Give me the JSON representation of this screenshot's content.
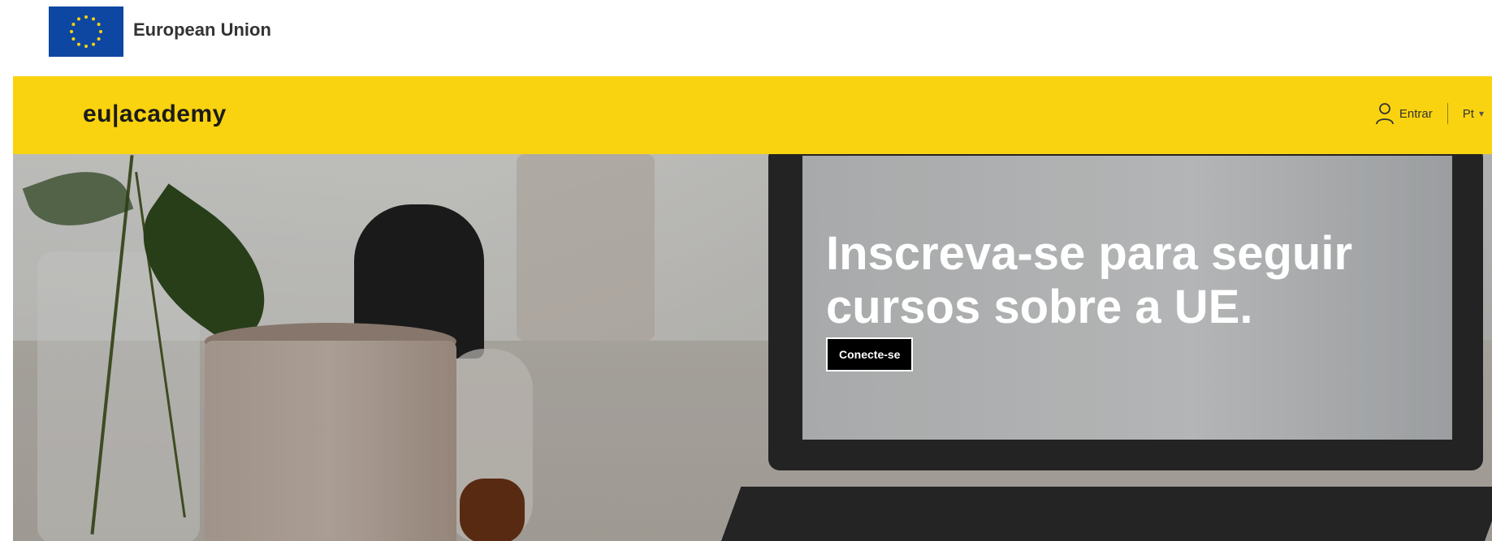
{
  "eu_bar": {
    "label": "European Union",
    "flag_color": "#0e47a1",
    "star_color": "#f9d30f"
  },
  "header": {
    "logo_text": "eu|academy",
    "background_color": "#f9d30f",
    "login": {
      "icon": "user-icon",
      "label": "Entrar"
    },
    "language": {
      "selected": "Pt",
      "icon": "chevron-down-icon"
    }
  },
  "hero": {
    "title": "Inscreva-se para seguir cursos sobre a UE.",
    "button_label": "Conecte-se"
  }
}
